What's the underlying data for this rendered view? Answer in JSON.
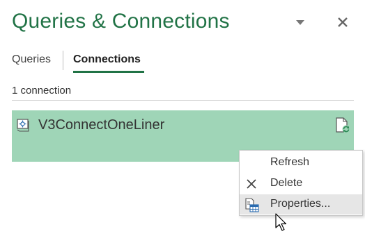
{
  "pane": {
    "title": "Queries & Connections",
    "menu_icon": "chevron-down-icon",
    "close_icon": "close-icon"
  },
  "tabs": [
    {
      "label": "Queries",
      "active": false
    },
    {
      "label": "Connections",
      "active": true
    }
  ],
  "connection_count": "1 connection",
  "connections": [
    {
      "name": "V3ConnectOneLiner",
      "icon": "connection-icon",
      "action_icon": "refresh-file-icon"
    }
  ],
  "context_menu": {
    "items": [
      {
        "label": "Refresh",
        "icon": ""
      },
      {
        "label": "Delete",
        "icon": "delete-x-icon"
      },
      {
        "label": "Properties...",
        "icon": "properties-icon",
        "highlighted": true
      }
    ]
  },
  "colors": {
    "accent": "#217346",
    "selected_row": "#9fd5b7",
    "menu_hover": "#e6e6e6"
  }
}
